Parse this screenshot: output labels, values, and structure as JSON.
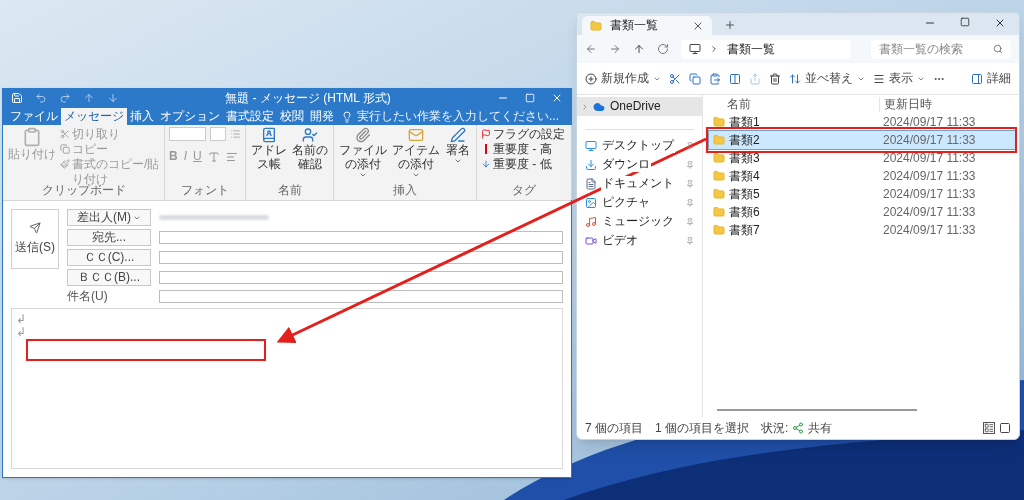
{
  "outlook": {
    "title": "無題 - メッセージ (HTML 形式)",
    "tabs": [
      {
        "label": "ファイル",
        "selected": false
      },
      {
        "label": "メッセージ",
        "selected": true
      },
      {
        "label": "挿入",
        "selected": false
      },
      {
        "label": "オプション",
        "selected": false
      },
      {
        "label": "書式設定",
        "selected": false
      },
      {
        "label": "校閲",
        "selected": false
      },
      {
        "label": "開発",
        "selected": false
      }
    ],
    "tell_me": "実行したい作業を入力してください...",
    "ribbon": {
      "clipboard": {
        "label": "クリップボード",
        "paste": "貼り付け",
        "cut": "切り取り",
        "copy": "コピー",
        "format_painter": "書式のコピー/貼り付け",
        "disabled": true
      },
      "font": {
        "label": "フォント",
        "bold": "B",
        "italic": "I",
        "underline": "U",
        "disabled": true
      },
      "names": {
        "label": "名前",
        "address_book": "アドレス帳",
        "check_names": "名前の確認"
      },
      "include": {
        "label": "挿入",
        "attach_file": "ファイルの添付",
        "attach_item": "アイテムの添付",
        "signature": "署名"
      },
      "tags": {
        "label": "タグ",
        "follow_up": "フラグの設定",
        "high": "重要度 - 高",
        "low": "重要度 - 低"
      }
    },
    "compose": {
      "send": "送信(S)",
      "from_button": "差出人(M)",
      "to_button": "宛先...",
      "cc_button": "ＣＣ(C)...",
      "bcc_button": "ＢＣＣ(B)...",
      "subject_label": "件名(U)",
      "body_marks": [
        "↲",
        "↲"
      ]
    }
  },
  "explorer": {
    "tab": "書類一覧",
    "address": "書類一覧",
    "search_placeholder": "書類一覧の検索",
    "toolbar": {
      "new": "新規作成",
      "sort": "並べ替え",
      "view": "表示",
      "details": "詳細"
    },
    "sidebar": [
      {
        "label": "OneDrive",
        "selected": true
      },
      {
        "label": "デスクトップ",
        "selected": false
      },
      {
        "label": "ダウンロ",
        "selected": false
      },
      {
        "label": "ドキュメント",
        "selected": false
      },
      {
        "label": "ピクチャ",
        "selected": false
      },
      {
        "label": "ミュージック",
        "selected": false
      },
      {
        "label": "ビデオ",
        "selected": false
      }
    ],
    "columns": [
      "名前",
      "更新日時"
    ],
    "rows": [
      {
        "name": "書類1",
        "modified": "2024/09/17 11:33",
        "selected": false,
        "annotated": false
      },
      {
        "name": "書類2",
        "modified": "2024/09/17 11:33",
        "selected": true,
        "annotated": true
      },
      {
        "name": "書類3",
        "modified": "2024/09/17 11:33",
        "selected": false,
        "annotated": false
      },
      {
        "name": "書類4",
        "modified": "2024/09/17 11:33",
        "selected": false,
        "annotated": false
      },
      {
        "name": "書類5",
        "modified": "2024/09/17 11:33",
        "selected": false,
        "annotated": false
      },
      {
        "name": "書類6",
        "modified": "2024/09/17 11:33",
        "selected": false,
        "annotated": false
      },
      {
        "name": "書類7",
        "modified": "2024/09/17 11:33",
        "selected": false,
        "annotated": false
      }
    ],
    "status": {
      "count": "7 個の項目",
      "selection": "1 個の項目を選択",
      "state_label": "状況:",
      "state": "共有"
    }
  }
}
